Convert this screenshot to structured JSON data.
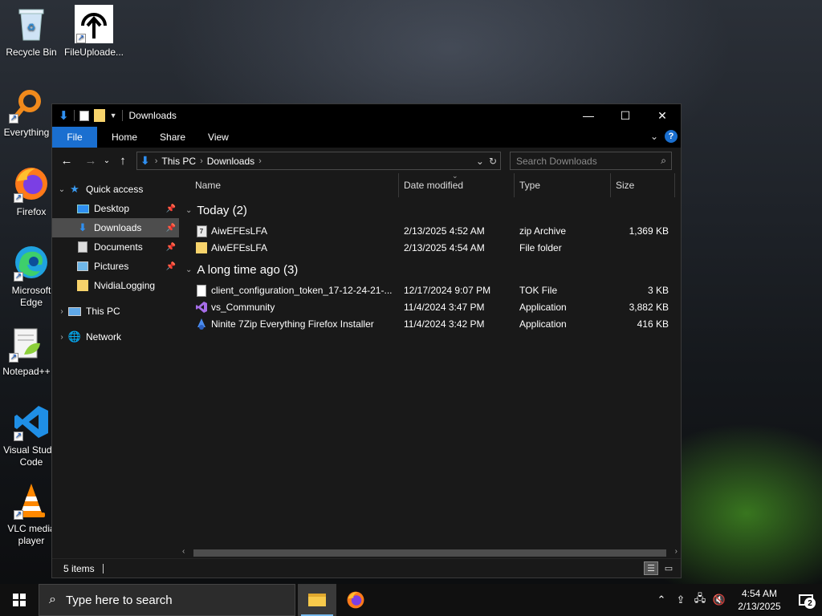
{
  "desktop": {
    "icons": [
      {
        "label": "Recycle Bin"
      },
      {
        "label": "FileUploade..."
      },
      {
        "label": "Everything"
      },
      {
        "label": "Firefox"
      },
      {
        "label": "Microsoft Edge"
      },
      {
        "label": "Notepad++"
      },
      {
        "label": "Visual Studio Code"
      },
      {
        "label": "VLC media player"
      }
    ]
  },
  "window": {
    "title": "Downloads",
    "ribbon_tabs": [
      "File",
      "Home",
      "Share",
      "View"
    ],
    "address": {
      "crumbs": [
        "This PC",
        "Downloads"
      ]
    },
    "search": {
      "placeholder": "Search Downloads"
    },
    "sidebar": {
      "items": [
        {
          "label": "Quick access",
          "icon": "star-icon"
        },
        {
          "label": "Desktop",
          "icon": "desktop-icon"
        },
        {
          "label": "Downloads",
          "icon": "download-arrow-icon"
        },
        {
          "label": "Documents",
          "icon": "document-icon"
        },
        {
          "label": "Pictures",
          "icon": "pictures-icon"
        },
        {
          "label": "NvidiaLogging",
          "icon": "folder-icon"
        },
        {
          "label": "This PC",
          "icon": "computer-icon"
        },
        {
          "label": "Network",
          "icon": "network-icon"
        }
      ]
    },
    "columns": {
      "name": "Name",
      "date": "Date modified",
      "type": "Type",
      "size": "Size"
    },
    "groups": [
      {
        "label": "Today (2)",
        "files": [
          {
            "name": "AiwEFEsLFA",
            "date": "2/13/2025 4:52 AM",
            "type": "zip Archive",
            "size": "1,369 KB",
            "icon": "zip-icon"
          },
          {
            "name": "AiwEFEsLFA",
            "date": "2/13/2025 4:54 AM",
            "type": "File folder",
            "size": "",
            "icon": "folder-icon"
          }
        ]
      },
      {
        "label": "A long time ago (3)",
        "files": [
          {
            "name": "client_configuration_token_17-12-24-21-...",
            "date": "12/17/2024 9:07 PM",
            "type": "TOK File",
            "size": "3 KB",
            "icon": "blank-file-icon"
          },
          {
            "name": "vs_Community",
            "date": "11/4/2024 3:47 PM",
            "type": "Application",
            "size": "3,882 KB",
            "icon": "visual-studio-icon"
          },
          {
            "name": "Ninite 7Zip Everything Firefox Installer",
            "date": "11/4/2024 3:42 PM",
            "type": "Application",
            "size": "416 KB",
            "icon": "ninite-icon"
          }
        ]
      }
    ],
    "status": {
      "items": "5 items"
    }
  },
  "taskbar": {
    "search_placeholder": "Type here to search",
    "time": "4:54 AM",
    "date": "2/13/2025",
    "notifications": "2"
  },
  "colors": {
    "accent": "#1a6fd0",
    "selection": "#4d4d4d",
    "window_bg": "#191919"
  }
}
